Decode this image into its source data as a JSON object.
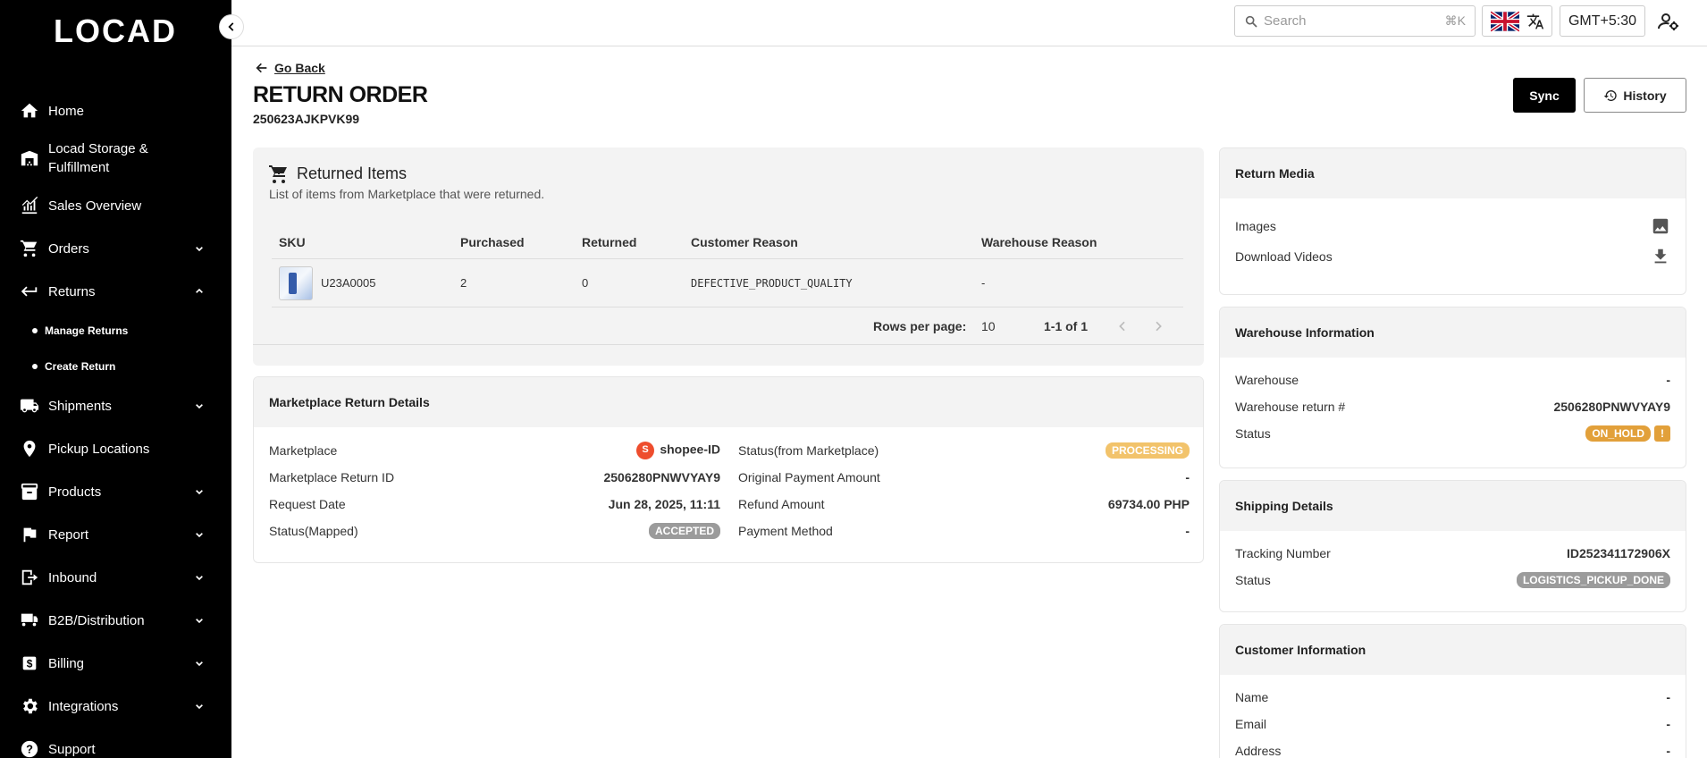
{
  "app": {
    "logo_text": "LOCAD"
  },
  "sidebar": {
    "items": [
      {
        "label": "Home",
        "icon": "home-icon"
      },
      {
        "label": "Locad Storage & Fulfillment",
        "icon": "warehouse-icon"
      },
      {
        "label": "Sales Overview",
        "icon": "chart-icon"
      },
      {
        "label": "Orders",
        "icon": "cart-icon"
      },
      {
        "label": "Returns",
        "icon": "return-icon"
      },
      {
        "label": "Shipments",
        "icon": "truck-icon"
      },
      {
        "label": "Pickup Locations",
        "icon": "pin-icon"
      },
      {
        "label": "Products",
        "icon": "box-icon"
      },
      {
        "label": "Report",
        "icon": "flag-icon"
      },
      {
        "label": "Inbound",
        "icon": "inbound-icon"
      },
      {
        "label": "B2B/Distribution",
        "icon": "distribution-icon"
      },
      {
        "label": "Billing",
        "icon": "billing-icon"
      },
      {
        "label": "Integrations",
        "icon": "gear-icon"
      },
      {
        "label": "Support",
        "icon": "help-icon"
      }
    ],
    "returns_sub": [
      {
        "label": "Manage Returns"
      },
      {
        "label": "Create Return"
      }
    ]
  },
  "topbar": {
    "search_placeholder": "Search",
    "search_shortcut": "⌘K",
    "timezone": "GMT+5:30"
  },
  "header": {
    "go_back": "Go Back",
    "title": "RETURN ORDER",
    "order_id": "250623AJKPVK99",
    "sync_label": "Sync",
    "history_label": "History"
  },
  "returned_items": {
    "title": "Returned Items",
    "subtitle": "List of items from Marketplace that were returned.",
    "columns": [
      "SKU",
      "Purchased",
      "Returned",
      "Customer Reason",
      "Warehouse Reason"
    ],
    "rows": [
      {
        "sku": "U23A0005",
        "purchased": "2",
        "returned": "0",
        "customer_reason": "DEFECTIVE_PRODUCT_QUALITY",
        "warehouse_reason": "-"
      }
    ],
    "rows_per_page_label": "Rows per page:",
    "rows_per_page": "10",
    "range": "1-1 of 1"
  },
  "marketplace_details": {
    "title": "Marketplace Return Details",
    "left": {
      "marketplace_label": "Marketplace",
      "marketplace_value": "shopee-ID",
      "return_id_label": "Marketplace Return ID",
      "return_id_value": "2506280PNWVYAY9",
      "request_date_label": "Request Date",
      "request_date_value": "Jun 28, 2025, 11:11",
      "status_mapped_label": "Status(Mapped)",
      "status_mapped_value": "ACCEPTED"
    },
    "right": {
      "status_mp_label": "Status(from Marketplace)",
      "status_mp_value": "PROCESSING",
      "orig_payment_label": "Original Payment Amount",
      "orig_payment_value": "-",
      "refund_label": "Refund Amount",
      "refund_value": "69734.00 PHP",
      "payment_method_label": "Payment Method",
      "payment_method_value": "-"
    }
  },
  "return_media": {
    "title": "Return Media",
    "images_label": "Images",
    "videos_label": "Download Videos"
  },
  "warehouse_info": {
    "title": "Warehouse Information",
    "warehouse_label": "Warehouse",
    "warehouse_value": "-",
    "return_no_label": "Warehouse return #",
    "return_no_value": "2506280PNWVYAY9",
    "status_label": "Status",
    "status_value": "ON_HOLD",
    "warn_symbol": "!"
  },
  "shipping_details": {
    "title": "Shipping Details",
    "tracking_label": "Tracking Number",
    "tracking_value": "ID252341172906X",
    "status_label": "Status",
    "status_value": "LOGISTICS_PICKUP_DONE"
  },
  "customer_info": {
    "title": "Customer Information",
    "name_label": "Name",
    "name_value": "-",
    "email_label": "Email",
    "email_value": "-",
    "address_label": "Address",
    "address_value": "-"
  },
  "colors": {
    "sidebar_bg": "#000000",
    "processing_badge": "#f2c36b",
    "on_hold_badge": "#e2a03a",
    "neutral_badge": "#9b9b9b",
    "shopee_brand": "#ee4d2d"
  }
}
